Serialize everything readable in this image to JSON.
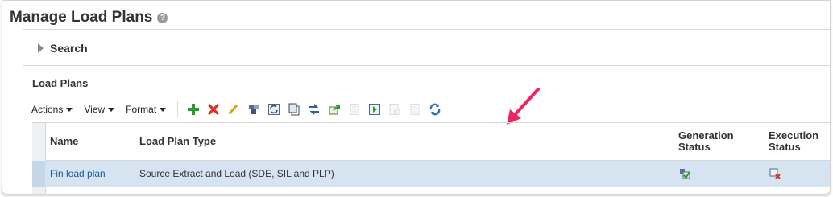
{
  "page": {
    "title": "Manage Load Plans",
    "help_icon": "help-icon"
  },
  "search": {
    "label": "Search",
    "state": "collapsed"
  },
  "load_plans": {
    "title": "Load Plans",
    "menus": [
      {
        "label": "Actions"
      },
      {
        "label": "View"
      },
      {
        "label": "Format"
      }
    ],
    "toolbar_icons": [
      {
        "name": "add-icon",
        "enabled": true
      },
      {
        "name": "delete-icon",
        "enabled": true
      },
      {
        "name": "edit-icon",
        "enabled": true
      },
      {
        "name": "generate-icon",
        "enabled": true
      },
      {
        "name": "refresh-icon",
        "enabled": true
      },
      {
        "name": "copy-icon",
        "enabled": true
      },
      {
        "name": "transfer-icon",
        "enabled": true
      },
      {
        "name": "export-icon",
        "enabled": true
      },
      {
        "name": "document-icon",
        "enabled": false
      },
      {
        "name": "execute-icon",
        "enabled": true
      },
      {
        "name": "schedule-icon",
        "enabled": false
      },
      {
        "name": "list-icon",
        "enabled": false
      },
      {
        "name": "sync-icon",
        "enabled": true
      }
    ],
    "columns": {
      "name": "Name",
      "type": "Load Plan Type",
      "generation_line1": "Generation",
      "generation_line2": "Status",
      "execution_line1": "Execution",
      "execution_line2": "Status"
    },
    "rows": [
      {
        "name": "Fin load plan",
        "type": "Source Extract and Load (SDE, SIL and PLP)",
        "generation_status_icon": "generation-succeeded-icon",
        "execution_status_icon": "execution-failed-icon"
      }
    ]
  },
  "annotation": {
    "color": "#f0245f"
  },
  "colors": {
    "selected_row": "#d6e3f0",
    "link": "#1b5c99"
  }
}
